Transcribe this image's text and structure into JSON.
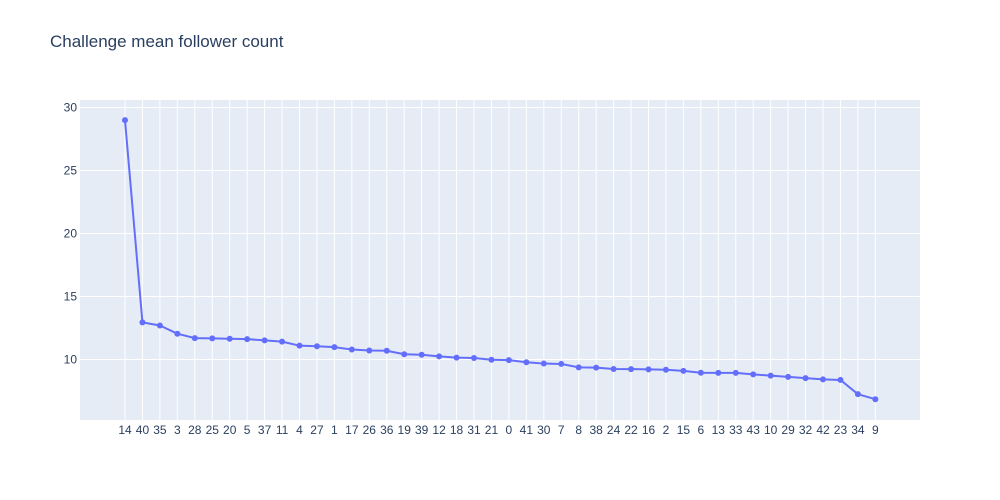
{
  "chart_data": {
    "type": "line",
    "title": "Challenge mean follower count",
    "xlabel": "",
    "ylabel": "",
    "categories": [
      "14",
      "40",
      "35",
      "3",
      "28",
      "25",
      "20",
      "5",
      "37",
      "11",
      "4",
      "27",
      "1",
      "17",
      "26",
      "36",
      "19",
      "39",
      "12",
      "18",
      "31",
      "21",
      "0",
      "41",
      "30",
      "7",
      "8",
      "38",
      "24",
      "22",
      "16",
      "2",
      "15",
      "6",
      "13",
      "33",
      "43",
      "10",
      "29",
      "32",
      "42",
      "23",
      "34",
      "9"
    ],
    "series": [
      {
        "values": [
          29.0,
          12.95,
          12.7,
          12.05,
          11.7,
          11.68,
          11.65,
          11.62,
          11.52,
          11.42,
          11.1,
          11.05,
          10.98,
          10.8,
          10.72,
          10.7,
          10.42,
          10.38,
          10.25,
          10.15,
          10.12,
          9.98,
          9.95,
          9.78,
          9.68,
          9.65,
          9.38,
          9.36,
          9.25,
          9.24,
          9.22,
          9.19,
          9.1,
          8.95,
          8.94,
          8.94,
          8.82,
          8.72,
          8.62,
          8.52,
          8.42,
          8.38,
          7.25,
          6.85
        ]
      }
    ],
    "yticks": [
      10,
      15,
      20,
      25,
      30
    ],
    "ylim": [
      5.2,
      30.6
    ],
    "grid": true,
    "legend": "none",
    "colors": {
      "line": "#636efa",
      "plot_bg": "#e5ecf6",
      "grid": "#ffffff",
      "text": "#2a3f5f"
    }
  }
}
